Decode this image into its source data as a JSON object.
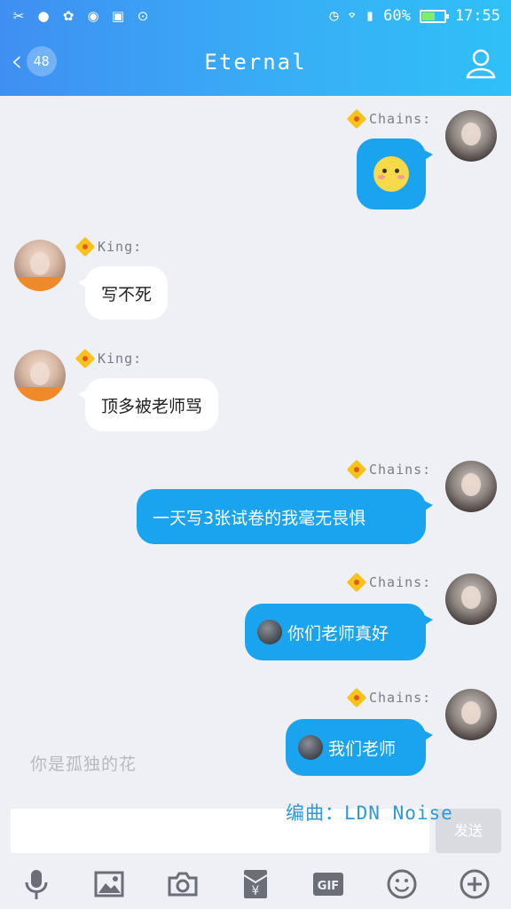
{
  "status_bar": {
    "battery": "60%",
    "time": "17:55",
    "battery_level": 0.6
  },
  "header": {
    "unread_count": "48",
    "title": "Eternal"
  },
  "messages": [
    {
      "sender": "Chains:",
      "side": "me",
      "type": "emoji"
    },
    {
      "sender": "King:",
      "side": "other",
      "text": "写不死"
    },
    {
      "sender": "King:",
      "side": "other",
      "text": "顶多被老师骂"
    },
    {
      "sender": "Chains:",
      "side": "me",
      "text": "一天写3张试卷的我毫无畏惧"
    },
    {
      "sender": "Chains:",
      "side": "me",
      "text": "你们老师真好",
      "leading_emoji": "moon"
    },
    {
      "sender": "Chains:",
      "side": "me",
      "text": "我们老师",
      "leading_emoji": "moon"
    }
  ],
  "overlay": {
    "lyric": "你是孤独的花",
    "credit": "编曲：LDN Noise"
  },
  "composer": {
    "input_value": "",
    "send_label": "发送"
  },
  "toolbar": [
    "microphone-icon",
    "image-icon",
    "camera-icon",
    "red-packet-icon",
    "gif-icon",
    "emoji-icon",
    "plus-icon"
  ],
  "colors": {
    "header_start": "#3f8ff2",
    "header_end": "#2fc0f7",
    "my_bubble": "#1aa3ee",
    "other_bubble": "#ffffff",
    "background": "#eef0f6"
  }
}
